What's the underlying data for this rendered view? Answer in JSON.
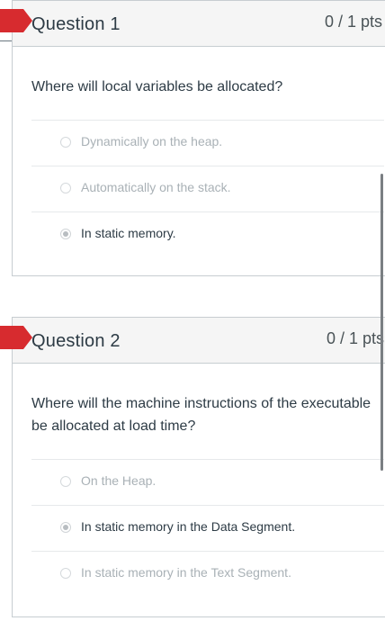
{
  "questions": [
    {
      "title": "Question 1",
      "points": "0 / 1 pts",
      "text": "Where will local variables be allocated?",
      "answers": [
        {
          "label": "Dynamically on the heap.",
          "selected": false
        },
        {
          "label": "Automatically on the stack.",
          "selected": false
        },
        {
          "label": "In static memory.",
          "selected": true
        }
      ]
    },
    {
      "title": "Question 2",
      "points": "0 / 1 pts",
      "text_line1": "Where will the machine instructions of the executable",
      "text_line2": "be allocated at load time?",
      "answers": [
        {
          "label": "On the Heap.",
          "selected": false
        },
        {
          "label": "In static memory in the Data Segment.",
          "selected": true
        },
        {
          "label": "In static memory in the Text Segment.",
          "selected": false
        }
      ]
    }
  ],
  "colors": {
    "flag": "#d72b2f",
    "header_bg": "#f5f5f5",
    "border": "#c7cdd1",
    "text": "#2d3b45",
    "muted_text": "#a9b1b6"
  },
  "icons": {
    "flag": "incorrect-flag-icon",
    "radio": "radio-button-icon"
  }
}
